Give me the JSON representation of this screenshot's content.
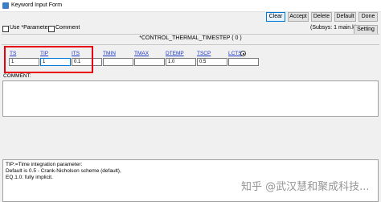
{
  "window": {
    "title": "Keyword Input Form"
  },
  "toolbar": {
    "clear_label": "Clear",
    "accept_label": "Accept",
    "delete_label": "Delete",
    "default_label": "Default",
    "done_label": "Done"
  },
  "options": {
    "use_parameter_label": "Use *Parameter",
    "comment_label": "Comment",
    "subsys_label": "(Subsys: 1 main.k)",
    "setting_label": "Setting"
  },
  "keyword": {
    "title": "*CONTROL_THERMAL_TIMESTEP    ( 0 )"
  },
  "fields": [
    {
      "label": "TS",
      "value": "1"
    },
    {
      "label": "TIP",
      "value": "1"
    },
    {
      "label": "ITS",
      "value": "0.1"
    },
    {
      "label": "TMIN",
      "value": ""
    },
    {
      "label": "TMAX",
      "value": ""
    },
    {
      "label": "DTEMP",
      "value": "1.0"
    },
    {
      "label": "TSCP",
      "value": "0.5"
    },
    {
      "label": "LCTS",
      "value": ""
    }
  ],
  "comment": {
    "label": "COMMENT:",
    "value": ""
  },
  "tip": {
    "lines": [
      "TIP:=Time integration parameter:",
      "Default is 0.5 - Crank-Nicholson scheme (default),",
      "EQ.1.0: fully implicit."
    ]
  },
  "watermark": {
    "text": "知乎 @武汉慧和聚成科技..."
  }
}
